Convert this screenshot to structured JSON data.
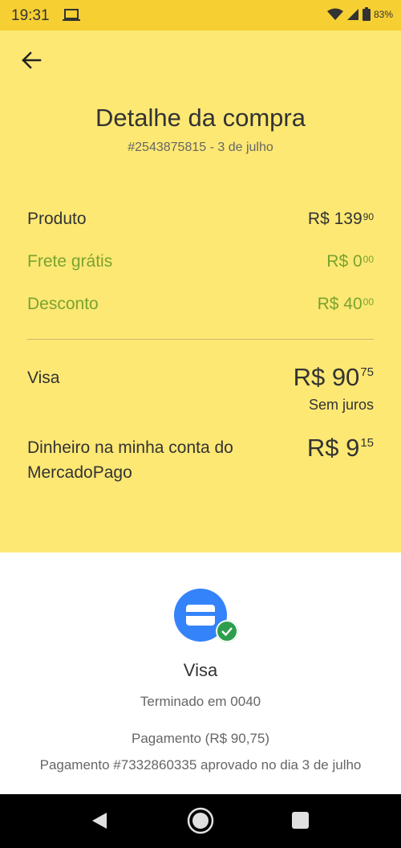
{
  "status_bar": {
    "time": "19:31",
    "battery": "83%"
  },
  "header": {
    "title": "Detalhe da compra",
    "subtitle": "#2543875815 - 3 de julho"
  },
  "summary": {
    "rows": [
      {
        "label": "Produto",
        "amount": "R$ 139",
        "cents": "90"
      },
      {
        "label": "Frete grátis",
        "amount": "R$ 0",
        "cents": "00"
      },
      {
        "label": "Desconto",
        "amount": "R$ 40",
        "cents": "00"
      }
    ]
  },
  "payments": [
    {
      "label": "Visa",
      "amount": "R$ 90",
      "cents": "75",
      "note": "Sem juros"
    },
    {
      "label_line1": "Dinheiro na minha conta do",
      "label_line2": "MercadoPago",
      "amount": "R$ 9",
      "cents": "15"
    }
  ],
  "detail": {
    "card_name": "Visa",
    "card_ending": "Terminado em 0040",
    "payment_amount": "Pagamento (R$ 90,75)",
    "payment_approved": "Pagamento #7332860335 aprovado no dia 3 de julho"
  },
  "colors": {
    "status_bar": "#f6cf33",
    "header_bg": "#fde874",
    "green": "#7aa32e",
    "accent_blue": "#3483fa",
    "check_green": "#2e9e4e"
  },
  "icons": [
    "laptop-icon",
    "wifi-icon",
    "signal-icon",
    "battery-icon",
    "back-arrow-icon",
    "credit-card-icon",
    "check-icon",
    "nav-back-icon",
    "nav-home-icon",
    "nav-recents-icon"
  ]
}
